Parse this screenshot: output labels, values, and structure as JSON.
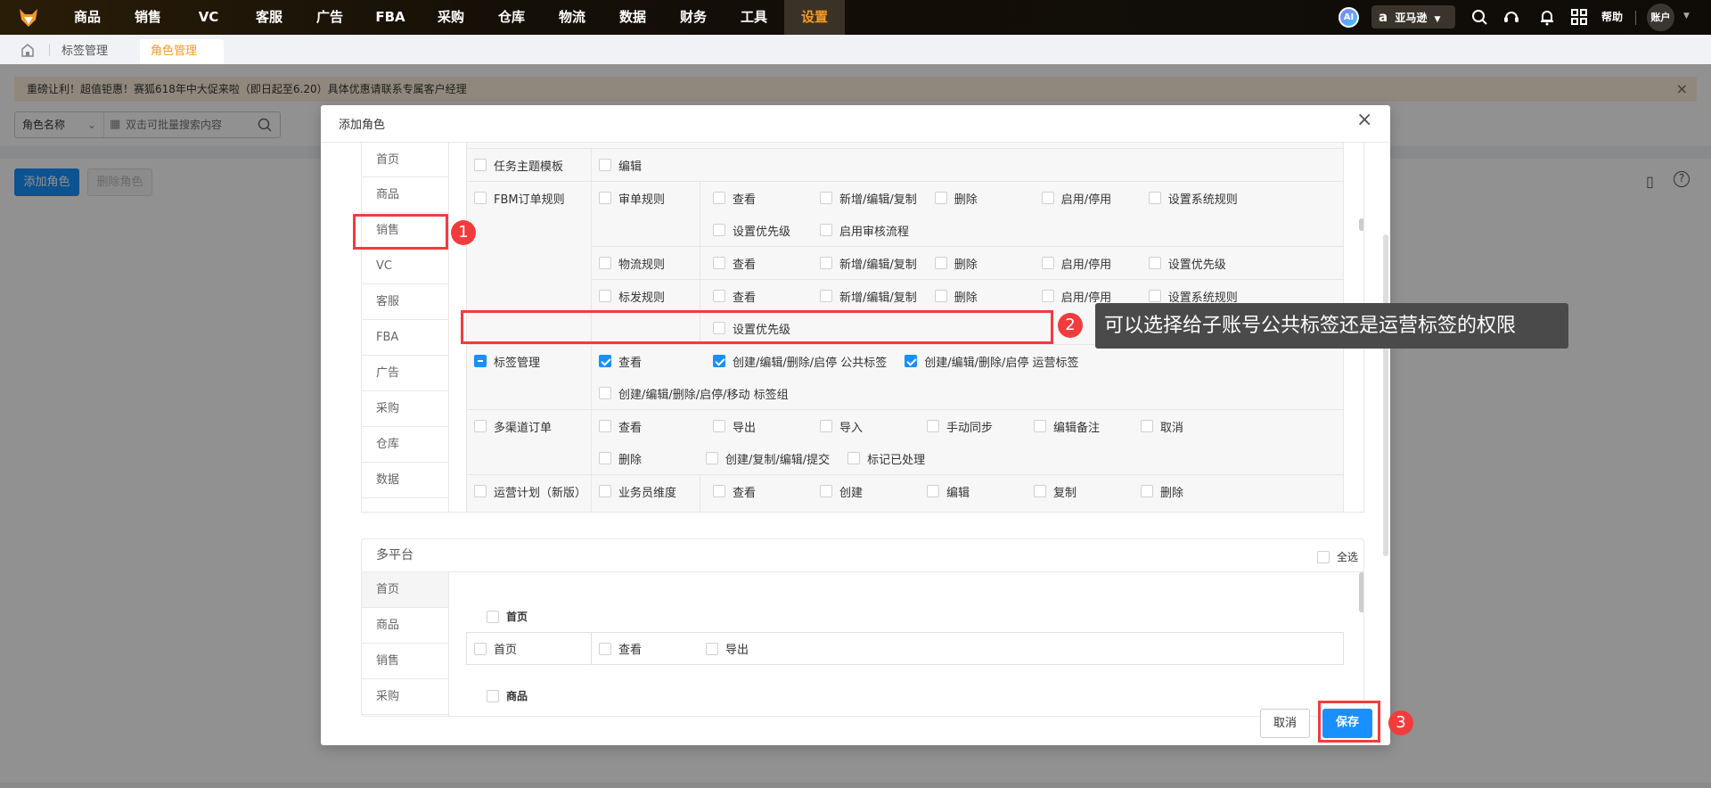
{
  "topbar": {
    "nav": [
      "商品",
      "销售",
      "VC",
      "客服",
      "广告",
      "FBA",
      "采购",
      "仓库",
      "物流",
      "数据",
      "财务",
      "工具",
      "设置"
    ],
    "active": "设置",
    "ai": "AI",
    "platform": "亚马逊",
    "help": "帮助",
    "account": "账户"
  },
  "tabs": {
    "items": [
      {
        "label": "标签管理"
      },
      {
        "label": "角色管理",
        "close": "×"
      }
    ]
  },
  "banner": {
    "text": "重磅让利！超值钜惠！赛狐618年中大促来啦（即日起至6.20）具体优惠请联系专属客户经理",
    "close": "×"
  },
  "search": {
    "field": "角色名称",
    "placeholder": "双击可批量搜索内容"
  },
  "toolbar": {
    "add": "添加角色",
    "delete": "删除角色"
  },
  "modal": {
    "title": "添加角色",
    "close": "×",
    "menu": [
      "首页",
      "商品",
      "销售",
      "VC",
      "客服",
      "FBA",
      "广告",
      "采购",
      "仓库",
      "数据"
    ],
    "rows": [
      {
        "label": "任务主题模板",
        "state": "off",
        "subs": [
          {
            "flow": true,
            "items": [
              {
                "t": "编辑"
              }
            ]
          }
        ]
      },
      {
        "label": "FBM订单规则",
        "state": "off",
        "subs": [
          {
            "sub": "审单规则",
            "items": [
              {
                "t": "查看"
              },
              {
                "t": "新增/编辑/复制"
              },
              {
                "t": "删除"
              },
              {
                "t": "启用/停用"
              },
              {
                "t": "设置系统规则"
              },
              {
                "t": "设置优先级"
              },
              {
                "t": "启用审核流程"
              }
            ]
          },
          {
            "sub": "物流规则",
            "items": [
              {
                "t": "查看"
              },
              {
                "t": "新增/编辑/复制"
              },
              {
                "t": "删除"
              },
              {
                "t": "启用/停用"
              },
              {
                "t": "设置优先级"
              }
            ]
          },
          {
            "sub": "标发规则",
            "items": [
              {
                "t": "查看"
              },
              {
                "t": "新增/编辑/复制"
              },
              {
                "t": "删除"
              },
              {
                "t": "启用/停用"
              },
              {
                "t": "设置系统规则"
              },
              {
                "t": "设置优先级"
              }
            ]
          }
        ]
      },
      {
        "label": "标签管理",
        "state": "half",
        "subs": [
          {
            "flow": true,
            "items": [
              {
                "t": "查看",
                "on": true
              },
              {
                "t": "创建/编辑/删除/启停 公共标签",
                "on": true
              },
              {
                "t": "创建/编辑/删除/启停 运营标签",
                "on": true
              },
              {
                "t": "创建/编辑/删除/启停/移动 标签组",
                "br": true
              }
            ]
          }
        ]
      },
      {
        "label": "多渠道订单",
        "state": "off",
        "subs": [
          {
            "flow": true,
            "items": [
              {
                "t": "查看"
              },
              {
                "t": "导出"
              },
              {
                "t": "导入"
              },
              {
                "t": "手动同步"
              },
              {
                "t": "编辑备注"
              },
              {
                "t": "取消"
              },
              {
                "t": "删除"
              },
              {
                "t": "创建/复制/编辑/提交"
              },
              {
                "t": "标记已处理",
                "tight": true
              }
            ]
          }
        ]
      },
      {
        "label": "运营计划（新版）",
        "state": "off",
        "subs": [
          {
            "sub": "业务员维度",
            "items": [
              {
                "t": "查看"
              },
              {
                "t": "创建"
              },
              {
                "t": "编辑"
              },
              {
                "t": "复制"
              },
              {
                "t": "删除"
              },
              {
                "t": "导入"
              },
              {
                "t": "导出"
              },
              {
                "t": "查看上周期数据"
              }
            ]
          }
        ]
      }
    ],
    "multi": {
      "title": "多平台",
      "select_all": "全选",
      "menu": [
        "首页",
        "商品",
        "销售",
        "采购"
      ],
      "group1": "首页",
      "row": {
        "label": "首页",
        "items": [
          "查看",
          "导出"
        ]
      },
      "group2": "商品"
    },
    "cancel": "取消",
    "save": "保存"
  },
  "annotations": {
    "b1": "1",
    "b2": "2",
    "b3": "3",
    "tooltip": "可以选择给子账号公共标签还是运营标签的权限"
  },
  "colors": {
    "accent": "#1890ff",
    "orange": "#f59a23",
    "red": "#f23c3c"
  }
}
